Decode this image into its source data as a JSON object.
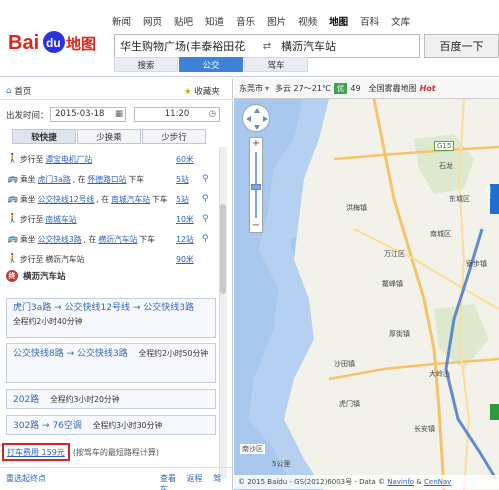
{
  "nav": [
    "新闻",
    "网页",
    "贴吧",
    "知道",
    "音乐",
    "图片",
    "视频",
    "地图",
    "百科",
    "文库"
  ],
  "nav_active": "地图",
  "logo": {
    "text": "Baidu",
    "paw": "du",
    "suffix": "地图",
    "colors": {
      "red": "#e1251b",
      "blue": "#2932e1"
    }
  },
  "search": {
    "from": "华生购物广场(丰泰裕田花",
    "to": "横沥汽车站",
    "button": "百度一下",
    "swap": "⇄"
  },
  "mode_tabs": [
    "搜索",
    "公交",
    "驾车"
  ],
  "mode_active": 1,
  "panel": {
    "home": "首页",
    "fav": "收藏夹",
    "time_label": "出发时间：",
    "date": "2015-03-18",
    "time": "11:20",
    "plan_tabs": [
      "较快捷",
      "少换乘",
      "少步行"
    ],
    "plan_active": 0,
    "steps": [
      {
        "type": "walk",
        "pre": "步行至",
        "link": "谭宝电机厂站",
        "mid": "",
        "link2": "",
        "post": "",
        "dist": "60米",
        "pin": false
      },
      {
        "type": "bus",
        "pre": "乘坐",
        "link": "虎门3a路",
        "mid": ", 在",
        "link2": "怀德路口站",
        "post": "下车",
        "dist": "5站",
        "pin": true
      },
      {
        "type": "bus",
        "pre": "乘坐",
        "link": "公交快线12号线",
        "mid": ", 在",
        "link2": "南城汽车站",
        "post": "下车",
        "dist": "5站",
        "pin": true
      },
      {
        "type": "walk",
        "pre": "步行至",
        "link": "南城车站",
        "mid": "",
        "link2": "",
        "post": "",
        "dist": "10米",
        "pin": true
      },
      {
        "type": "bus",
        "pre": "乘坐",
        "link": "公交快线3路",
        "mid": ", 在",
        "link2": "横沥汽车站",
        "post": "下车",
        "dist": "12站",
        "pin": true
      },
      {
        "type": "walk",
        "pre": "步行至",
        "link": "",
        "mid": "横沥汽车站",
        "link2": "",
        "post": "",
        "dist": "90米",
        "pin": false
      }
    ],
    "destination": "横沥汽车站",
    "dest_icon": "终",
    "plans": [
      {
        "title": "虎门3a路 → 公交快线12号线 → 公交快线3路",
        "summary": "全程约2小时40分钟"
      },
      {
        "title": "公交快线8路 → 公交快线3路",
        "summary": "全程约2小时50分钟"
      },
      {
        "title": "202路",
        "summary": "全程约3小时20分钟"
      },
      {
        "title": "302路 → 76空调",
        "summary": "全程约3小时30分钟"
      }
    ],
    "taxi": "打车费用 159元",
    "taxi_note": "(按驾车的最短路程计算)",
    "bottom_left": "重选起终点",
    "bottom_right": [
      "查看",
      "返程",
      "驾车"
    ]
  },
  "map": {
    "city": "东莞市",
    "weather": "多云 27～21℃",
    "aqi": "优",
    "aqi_val": "49",
    "event": "全国雾霾地图",
    "hot": "Hot",
    "copyright": "© 2015 Baidu - GS(2012)6003号 - Data ©",
    "copy_link1": "Navinfo",
    "copy_amp": "&",
    "copy_link2": "CenNav",
    "road_g15": "G15",
    "labels": {
      "l1": "黄埔区",
      "l2": "洪梅镇",
      "l3": "南城区",
      "l4": "万江区",
      "l5": "东城区",
      "l6": "鳌峰镇",
      "l7": "厚街镇",
      "l8": "虎门镇",
      "l9": "长安镇",
      "l10": "大岭山",
      "l11": "寮步镇",
      "l12": "石龙",
      "l13": "南沙区",
      "l14": "沙田镇",
      "l15": "东莞"
    },
    "side_label": "乘车",
    "scale": "5公里"
  }
}
